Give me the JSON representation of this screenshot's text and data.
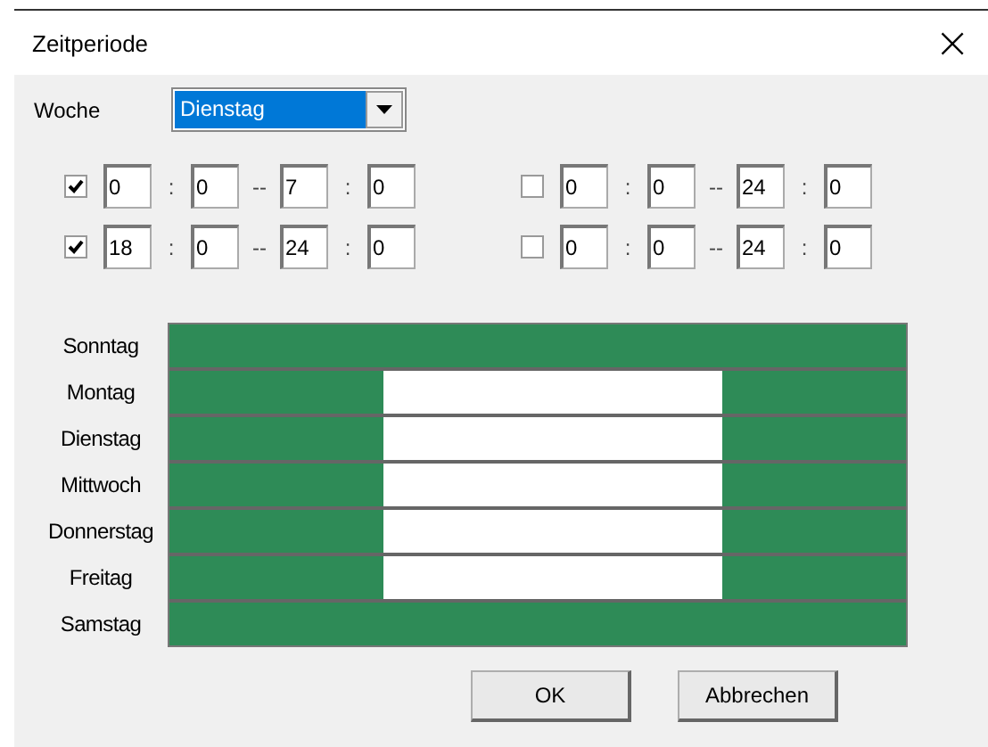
{
  "window": {
    "title": "Zeitperiode",
    "close": "×"
  },
  "week": {
    "label": "Woche",
    "value": "Dienstag"
  },
  "periods": [
    {
      "checked": true,
      "fields": [
        "0",
        "0",
        "7",
        "0"
      ],
      "separators": [
        ":",
        "--",
        ":"
      ]
    },
    {
      "checked": false,
      "fields": [
        "0",
        "0",
        "24",
        "0"
      ],
      "separators": [
        ":",
        "--",
        ":"
      ]
    },
    {
      "checked": true,
      "fields": [
        "18",
        "0",
        "24",
        "0"
      ],
      "separators": [
        ":",
        "--",
        ":"
      ]
    },
    {
      "checked": false,
      "fields": [
        "0",
        "0",
        "24",
        "0"
      ],
      "separators": [
        ":",
        "--",
        ":"
      ]
    }
  ],
  "schedule": {
    "days": [
      {
        "label": "Sonntag",
        "hours": [
          true,
          true,
          true,
          true,
          true,
          true,
          true,
          true,
          true,
          true,
          true,
          true,
          true,
          true,
          true,
          true,
          true,
          true,
          true,
          true,
          true,
          true,
          true,
          true
        ]
      },
      {
        "label": "Montag",
        "hours": [
          true,
          true,
          true,
          true,
          true,
          true,
          true,
          false,
          false,
          false,
          false,
          false,
          false,
          false,
          false,
          false,
          false,
          false,
          true,
          true,
          true,
          true,
          true,
          true
        ]
      },
      {
        "label": "Dienstag",
        "hours": [
          true,
          true,
          true,
          true,
          true,
          true,
          true,
          false,
          false,
          false,
          false,
          false,
          false,
          false,
          false,
          false,
          false,
          false,
          true,
          true,
          true,
          true,
          true,
          true
        ]
      },
      {
        "label": "Mittwoch",
        "hours": [
          true,
          true,
          true,
          true,
          true,
          true,
          true,
          false,
          false,
          false,
          false,
          false,
          false,
          false,
          false,
          false,
          false,
          false,
          true,
          true,
          true,
          true,
          true,
          true
        ]
      },
      {
        "label": "Donnerstag",
        "hours": [
          true,
          true,
          true,
          true,
          true,
          true,
          true,
          false,
          false,
          false,
          false,
          false,
          false,
          false,
          false,
          false,
          false,
          false,
          true,
          true,
          true,
          true,
          true,
          true
        ]
      },
      {
        "label": "Freitag",
        "hours": [
          true,
          true,
          true,
          true,
          true,
          true,
          true,
          false,
          false,
          false,
          false,
          false,
          false,
          false,
          false,
          false,
          false,
          false,
          true,
          true,
          true,
          true,
          true,
          true
        ]
      },
      {
        "label": "Samstag",
        "hours": [
          true,
          true,
          true,
          true,
          true,
          true,
          true,
          true,
          true,
          true,
          true,
          true,
          true,
          true,
          true,
          true,
          true,
          true,
          true,
          true,
          true,
          true,
          true,
          true
        ]
      }
    ]
  },
  "buttons": [
    "OK",
    "Abbrechen"
  ]
}
